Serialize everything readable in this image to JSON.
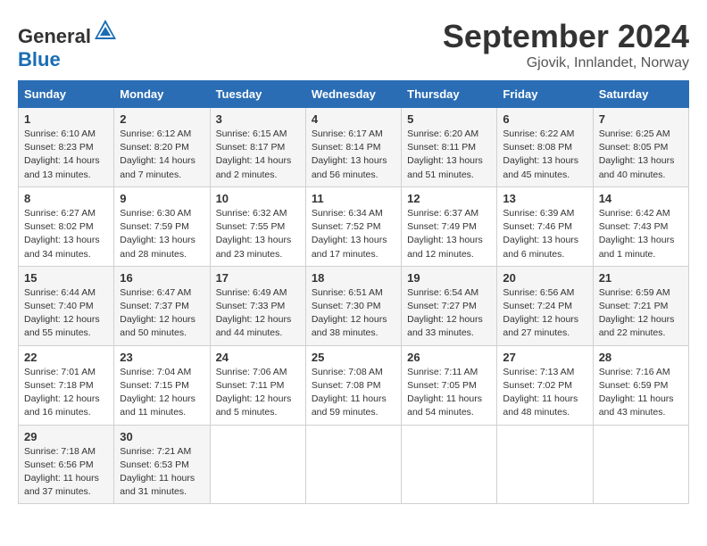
{
  "header": {
    "logo_general": "General",
    "logo_blue": "Blue",
    "month_title": "September 2024",
    "location": "Gjovik, Innlandet, Norway"
  },
  "weekdays": [
    "Sunday",
    "Monday",
    "Tuesday",
    "Wednesday",
    "Thursday",
    "Friday",
    "Saturday"
  ],
  "weeks": [
    [
      {
        "day": "1",
        "sunrise": "6:10 AM",
        "sunset": "8:23 PM",
        "daylight": "14 hours and 13 minutes."
      },
      {
        "day": "2",
        "sunrise": "6:12 AM",
        "sunset": "8:20 PM",
        "daylight": "14 hours and 7 minutes."
      },
      {
        "day": "3",
        "sunrise": "6:15 AM",
        "sunset": "8:17 PM",
        "daylight": "14 hours and 2 minutes."
      },
      {
        "day": "4",
        "sunrise": "6:17 AM",
        "sunset": "8:14 PM",
        "daylight": "13 hours and 56 minutes."
      },
      {
        "day": "5",
        "sunrise": "6:20 AM",
        "sunset": "8:11 PM",
        "daylight": "13 hours and 51 minutes."
      },
      {
        "day": "6",
        "sunrise": "6:22 AM",
        "sunset": "8:08 PM",
        "daylight": "13 hours and 45 minutes."
      },
      {
        "day": "7",
        "sunrise": "6:25 AM",
        "sunset": "8:05 PM",
        "daylight": "13 hours and 40 minutes."
      }
    ],
    [
      {
        "day": "8",
        "sunrise": "6:27 AM",
        "sunset": "8:02 PM",
        "daylight": "13 hours and 34 minutes."
      },
      {
        "day": "9",
        "sunrise": "6:30 AM",
        "sunset": "7:59 PM",
        "daylight": "13 hours and 28 minutes."
      },
      {
        "day": "10",
        "sunrise": "6:32 AM",
        "sunset": "7:55 PM",
        "daylight": "13 hours and 23 minutes."
      },
      {
        "day": "11",
        "sunrise": "6:34 AM",
        "sunset": "7:52 PM",
        "daylight": "13 hours and 17 minutes."
      },
      {
        "day": "12",
        "sunrise": "6:37 AM",
        "sunset": "7:49 PM",
        "daylight": "13 hours and 12 minutes."
      },
      {
        "day": "13",
        "sunrise": "6:39 AM",
        "sunset": "7:46 PM",
        "daylight": "13 hours and 6 minutes."
      },
      {
        "day": "14",
        "sunrise": "6:42 AM",
        "sunset": "7:43 PM",
        "daylight": "13 hours and 1 minute."
      }
    ],
    [
      {
        "day": "15",
        "sunrise": "6:44 AM",
        "sunset": "7:40 PM",
        "daylight": "12 hours and 55 minutes."
      },
      {
        "day": "16",
        "sunrise": "6:47 AM",
        "sunset": "7:37 PM",
        "daylight": "12 hours and 50 minutes."
      },
      {
        "day": "17",
        "sunrise": "6:49 AM",
        "sunset": "7:33 PM",
        "daylight": "12 hours and 44 minutes."
      },
      {
        "day": "18",
        "sunrise": "6:51 AM",
        "sunset": "7:30 PM",
        "daylight": "12 hours and 38 minutes."
      },
      {
        "day": "19",
        "sunrise": "6:54 AM",
        "sunset": "7:27 PM",
        "daylight": "12 hours and 33 minutes."
      },
      {
        "day": "20",
        "sunrise": "6:56 AM",
        "sunset": "7:24 PM",
        "daylight": "12 hours and 27 minutes."
      },
      {
        "day": "21",
        "sunrise": "6:59 AM",
        "sunset": "7:21 PM",
        "daylight": "12 hours and 22 minutes."
      }
    ],
    [
      {
        "day": "22",
        "sunrise": "7:01 AM",
        "sunset": "7:18 PM",
        "daylight": "12 hours and 16 minutes."
      },
      {
        "day": "23",
        "sunrise": "7:04 AM",
        "sunset": "7:15 PM",
        "daylight": "12 hours and 11 minutes."
      },
      {
        "day": "24",
        "sunrise": "7:06 AM",
        "sunset": "7:11 PM",
        "daylight": "12 hours and 5 minutes."
      },
      {
        "day": "25",
        "sunrise": "7:08 AM",
        "sunset": "7:08 PM",
        "daylight": "11 hours and 59 minutes."
      },
      {
        "day": "26",
        "sunrise": "7:11 AM",
        "sunset": "7:05 PM",
        "daylight": "11 hours and 54 minutes."
      },
      {
        "day": "27",
        "sunrise": "7:13 AM",
        "sunset": "7:02 PM",
        "daylight": "11 hours and 48 minutes."
      },
      {
        "day": "28",
        "sunrise": "7:16 AM",
        "sunset": "6:59 PM",
        "daylight": "11 hours and 43 minutes."
      }
    ],
    [
      {
        "day": "29",
        "sunrise": "7:18 AM",
        "sunset": "6:56 PM",
        "daylight": "11 hours and 37 minutes."
      },
      {
        "day": "30",
        "sunrise": "7:21 AM",
        "sunset": "6:53 PM",
        "daylight": "11 hours and 31 minutes."
      },
      null,
      null,
      null,
      null,
      null
    ]
  ],
  "labels": {
    "sunrise_label": "Sunrise: ",
    "sunset_label": "Sunset: ",
    "daylight_label": "Daylight: "
  }
}
